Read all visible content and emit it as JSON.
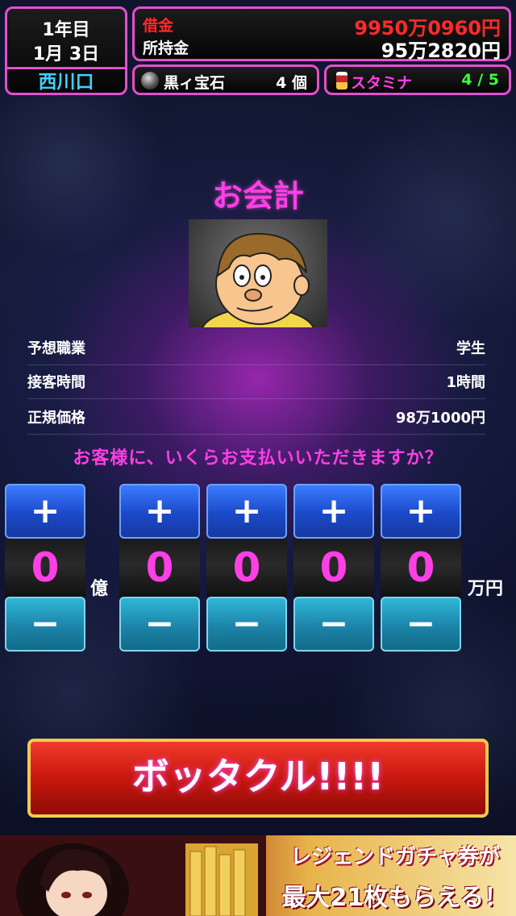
{
  "status": {
    "year": "1年目",
    "date": "1月 3日",
    "location": "西川口"
  },
  "money": {
    "debt_label": "借金",
    "debt_value": "9950万0960円",
    "cash_label": "所持金",
    "cash_value": "95万2820円",
    "debt_color": "#ff2a2a"
  },
  "items": {
    "gem_label": "黒ィ宝石",
    "gem_count": "4 個",
    "stamina_label": "スタミナ",
    "stamina_value": "4 / 5",
    "stamina_color": "#3dff3d"
  },
  "checkout": {
    "title": "お会計",
    "rows": [
      {
        "label": "予想職業",
        "value": "学生"
      },
      {
        "label": "接客時間",
        "value": "1時間"
      },
      {
        "label": "正規価格",
        "value": "98万1000円"
      }
    ],
    "question": "お客様に、いくらお支払いいただきますか？"
  },
  "price_input": {
    "plus_label": "+",
    "minus_label": "−",
    "digits": [
      "0",
      "0",
      "0",
      "0",
      "0"
    ],
    "oku_unit": "億",
    "man_unit": "万円"
  },
  "action": {
    "button_label": "ボッタクル!!!!"
  },
  "banner": {
    "line1": "レジェンドガチャ券が",
    "line2": "最大21枚もらえる！"
  },
  "colors": {
    "accent_pink": "#ff3fe6",
    "panel_border": "#e34fcf",
    "location_blue": "#3fd0ff"
  },
  "icons": {
    "gem": "black-gem-icon",
    "stamina": "stamina-drink-icon"
  }
}
